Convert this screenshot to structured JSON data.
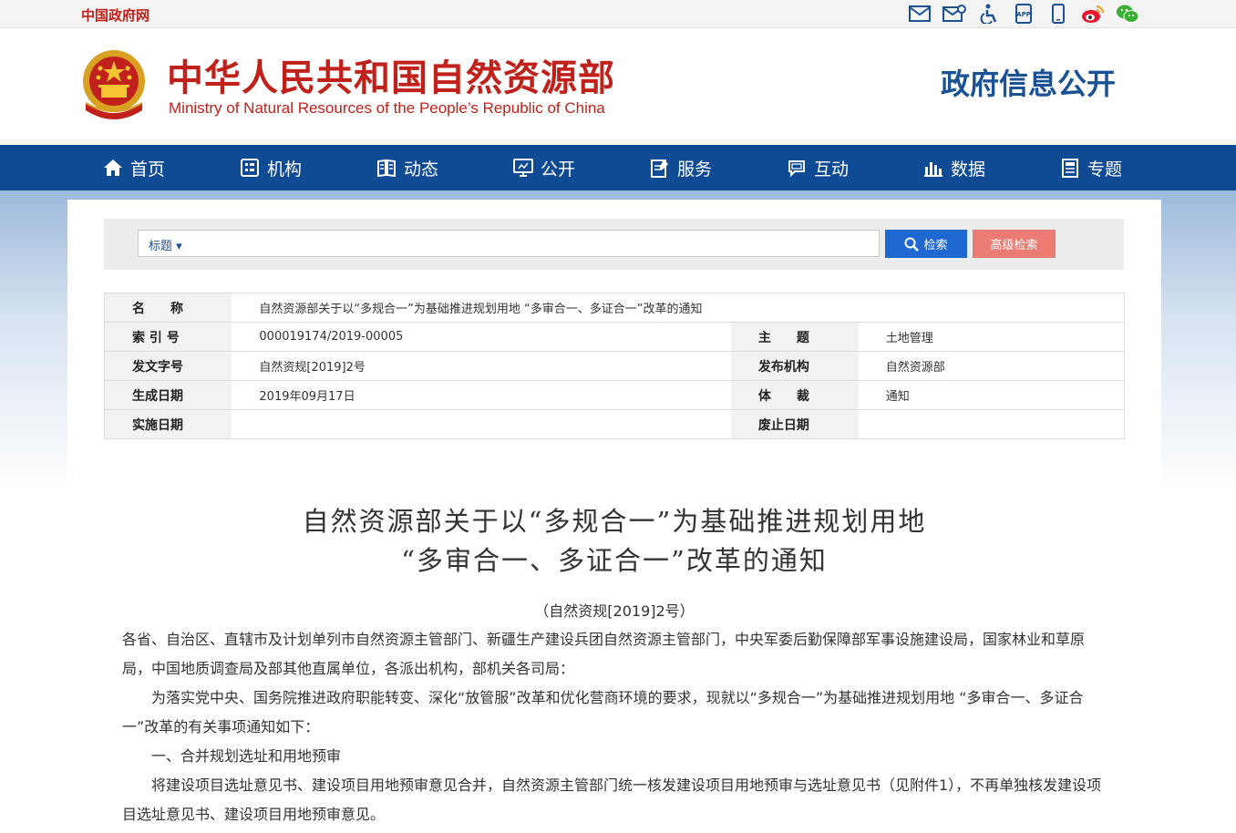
{
  "topbar": {
    "gov_link": "中国政府网",
    "icons": [
      "mail-icon",
      "mail-settings-icon",
      "accessibility-icon",
      "app-icon",
      "mobile-icon",
      "weibo-icon",
      "wechat-icon"
    ]
  },
  "header": {
    "title_cn": "中华人民共和国自然资源部",
    "title_en": "Ministry of Natural Resources of the People’s Republic of China",
    "right_title": "政府信息公开"
  },
  "nav": {
    "items": [
      {
        "label": "首页",
        "icon": "home-icon"
      },
      {
        "label": "机构",
        "icon": "org-icon"
      },
      {
        "label": "动态",
        "icon": "book-icon"
      },
      {
        "label": "公开",
        "icon": "monitor-icon"
      },
      {
        "label": "服务",
        "icon": "edit-icon"
      },
      {
        "label": "互动",
        "icon": "chat-icon"
      },
      {
        "label": "数据",
        "icon": "bar-chart-icon"
      },
      {
        "label": "专题",
        "icon": "doc-icon"
      }
    ]
  },
  "search": {
    "field": "标题",
    "placeholder": "",
    "search_label": "检索",
    "advanced_label": "高级检索"
  },
  "info": {
    "name_label": "名　　称",
    "name_value": "自然资源部关于以“多规合一”为基础推进规划用地 “多审合一、多证合一”改革的通知",
    "index_label": "索 引 号",
    "index_value": "000019174/2019-00005",
    "topic_label": "主　　题",
    "topic_value": "土地管理",
    "doc_no_label": "发文字号",
    "doc_no_value": "自然资规[2019]2号",
    "issuer_label": "发布机构",
    "issuer_value": "自然资源部",
    "date_label": "生成日期",
    "date_value": "2019年09月17日",
    "genre_label": "体　　裁",
    "genre_value": "通知",
    "effective_label": "实施日期",
    "effective_value": "",
    "expire_label": "废止日期",
    "expire_value": ""
  },
  "document": {
    "title_line1": "自然资源部关于以“多规合一”为基础推进规划用地",
    "title_line2": "“多审合一、多证合一”改革的通知",
    "number": "（自然资规[2019]2号）",
    "addressee": "各省、自治区、直辖市及计划单列市自然资源主管部门、新疆生产建设兵团自然资源主管部门，中央军委后勤保障部军事设施建设局，国家林业和草原局，中国地质调查局及部其他直属单位，各派出机构，部机关各司局：",
    "para1": "为落实党中央、国务院推进政府职能转变、深化“放管服”改革和优化营商环境的要求，现就以“多规合一”为基础推进规划用地 “多审合一、多证合一”改革的有关事项通知如下：",
    "heading1": "一、合并规划选址和用地预审",
    "para2": "将建设项目选址意见书、建设项目用地预审意见合并，自然资源主管部门统一核发建设项目用地预审与选址意见书（见附件1），不再单独核发建设项目选址意见书、建设项目用地预审意见。"
  }
}
